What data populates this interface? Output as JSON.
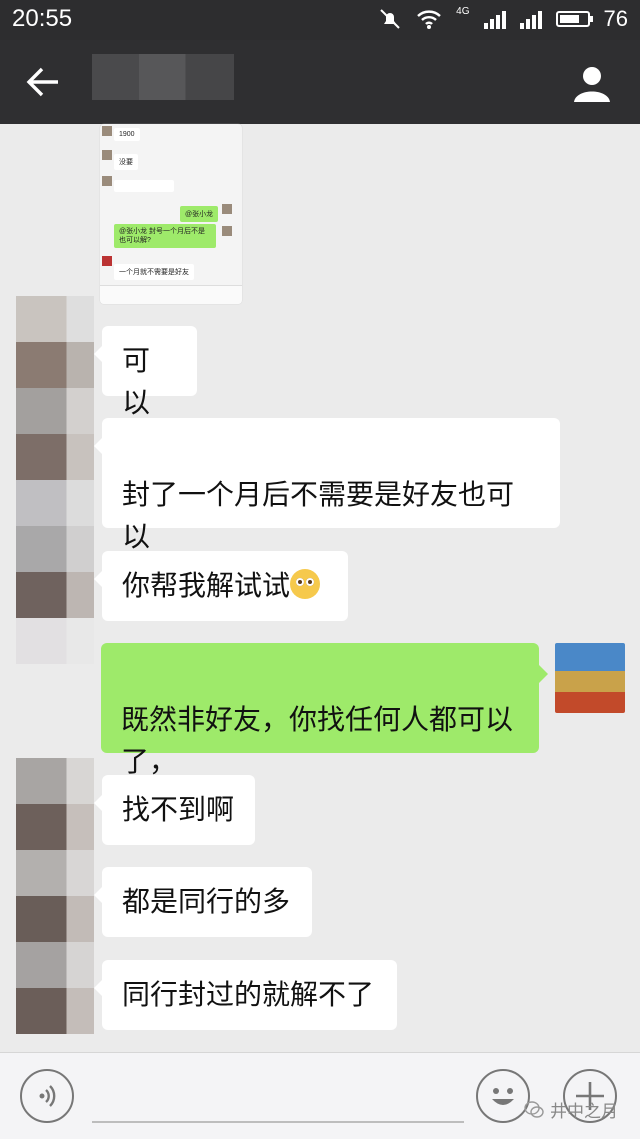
{
  "status_bar": {
    "time": "20:55",
    "network": "4G",
    "battery": "76",
    "battery_level": 0.76
  },
  "header": {
    "back_icon": "arrow-left-icon",
    "profile_icon": "person-icon"
  },
  "thumbnail": {
    "messages": [
      "1900",
      "没要",
      "@张小龙",
      "@张小龙 封号一个月后不是也可以解?",
      "一个月就不需要是好友"
    ]
  },
  "messages": [
    {
      "side": "left",
      "text": "可以"
    },
    {
      "side": "left",
      "text": "封了一个月后不需要是好友也可以\n解"
    },
    {
      "side": "left",
      "text": "你帮我解试试",
      "emoji": "pleading-face-icon"
    },
    {
      "side": "right",
      "text": "既然非好友，你找任何人都可以\n了，"
    },
    {
      "side": "left",
      "text": "找不到啊"
    },
    {
      "side": "left",
      "text": "都是同行的多"
    },
    {
      "side": "left",
      "text": "同行封过的就解不了"
    }
  ],
  "bottom_bar": {
    "watermark": "井中之月"
  },
  "colors": {
    "bubble_me": "#9eea6a",
    "bubble_other": "#ffffff",
    "background": "#ebebeb",
    "header": "#2f2f31"
  }
}
